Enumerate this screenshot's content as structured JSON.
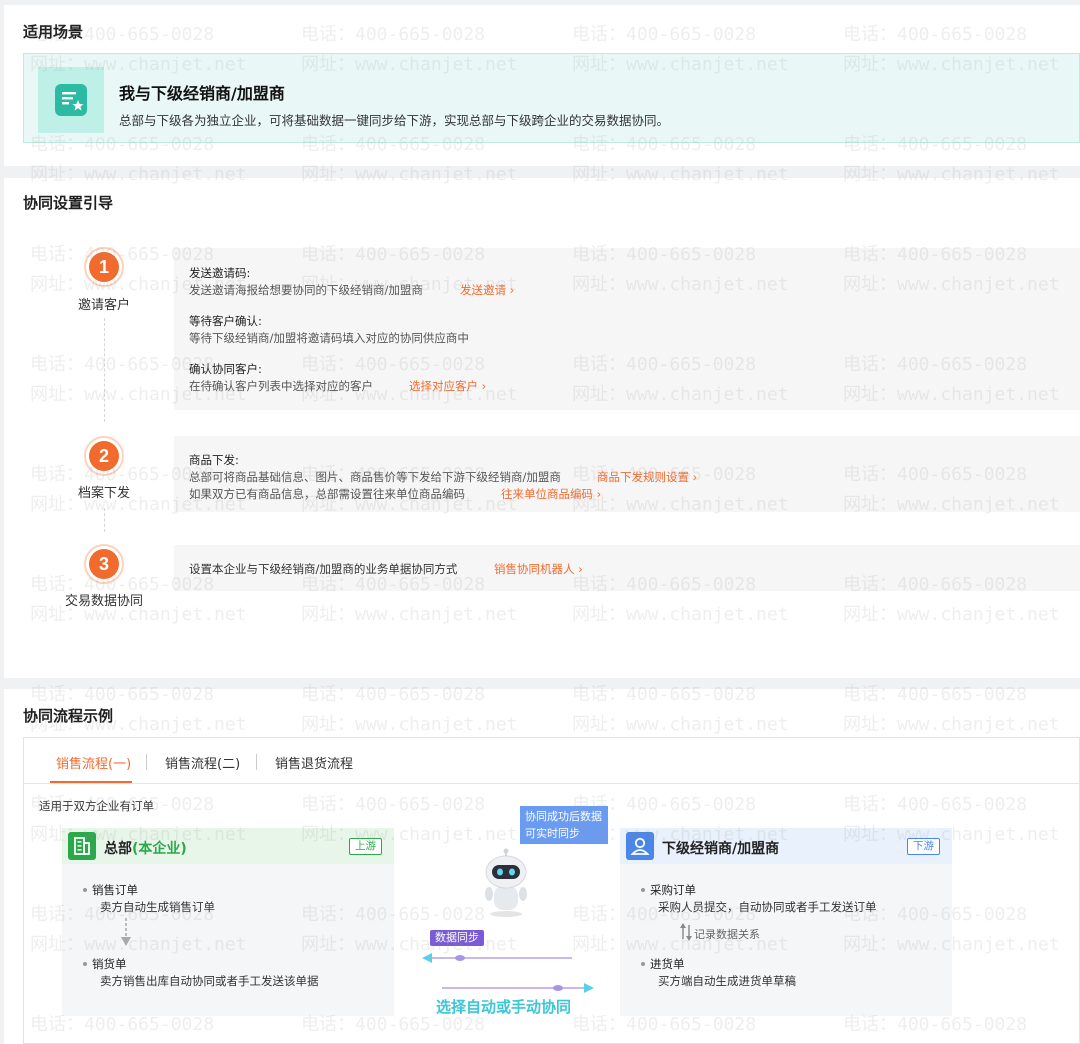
{
  "scene": {
    "title": "适用场景",
    "card_title": "我与下级经销商/加盟商",
    "card_desc": "总部与下级各为独立企业，可将基础数据一键同步给下游，实现总部与下级跨企业的交易数据协同。",
    "icon": "document-star-icon",
    "accent": "#2bbba3"
  },
  "guide": {
    "title": "协同设置引导",
    "steps": [
      {
        "num": "1",
        "label": "邀请客户",
        "items": [
          {
            "title": "发送邀请码:",
            "desc": "发送邀请海报给想要协同的下级经销商/加盟商",
            "link": "发送邀请"
          },
          {
            "title": "等待客户确认:",
            "desc": "等待下级经销商/加盟将邀请码填入对应的协同供应商中"
          },
          {
            "title": "确认协同客户:",
            "desc": "在待确认客户列表中选择对应的客户",
            "link": "选择对应客户"
          }
        ]
      },
      {
        "num": "2",
        "label": "档案下发",
        "items": [
          {
            "title": "商品下发:",
            "desc": "总部可将商品基础信息、图片、商品售价等下发给下游下级经销商/加盟商",
            "link": "商品下发规则设置"
          },
          {
            "desc": "如果双方已有商品信息，总部需设置往来单位商品编码",
            "link": "往来单位商品编码"
          }
        ]
      },
      {
        "num": "3",
        "label": "交易数据协同",
        "items": [
          {
            "desc": "设置本企业与下级经销商/加盟商的业务单据协同方式",
            "link": "销售协同机器人"
          }
        ]
      }
    ],
    "accent": "#f26b2e"
  },
  "flow": {
    "title": "协同流程示例",
    "tabs": [
      "销售流程(一)",
      "销售流程(二)",
      "销售退货流程"
    ],
    "active_tab": 0,
    "note": "适用于双方企业有订单",
    "hq": {
      "title": "总部",
      "title_hl": "(本企业)",
      "badge": "上游",
      "icon": "building-icon",
      "items": [
        {
          "title": "销售订单",
          "desc": "卖方自动生成销售订单"
        },
        {
          "title": "销货单",
          "desc": "卖方销售出库自动协同或者手工发送该单据"
        }
      ]
    },
    "sub": {
      "title": "下级经销商/加盟商",
      "badge": "下游",
      "icon": "user-icon",
      "items": [
        {
          "title": "采购订单",
          "desc": "采购人员提交，自动协同或者手工发送订单"
        },
        {
          "title": "进货单",
          "desc": "买方端自动生成进货单草稿"
        }
      ],
      "relation": "记录数据关系"
    },
    "bubble_line1": "协同成功后数据",
    "bubble_line2": "可实时同步",
    "sync_pill": "数据同步",
    "auto_text": "选择自动或手动协同",
    "colors": {
      "green": "#2ba84a",
      "blue": "#4a86e8",
      "cyan": "#3cc6d6",
      "purple": "#7a5ad6"
    }
  },
  "watermark": {
    "phone": "电话：400-665-0028",
    "site": "网址：www.chanjet.net"
  }
}
